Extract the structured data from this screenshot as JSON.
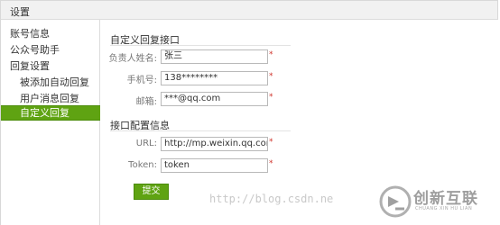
{
  "header": {
    "title": "设置"
  },
  "sidebar": {
    "items": [
      {
        "label": "账号信息"
      },
      {
        "label": "公众号助手"
      },
      {
        "label": "回复设置"
      },
      {
        "label": "被添加自动回复"
      },
      {
        "label": "用户消息回复"
      },
      {
        "label": "自定义回复"
      }
    ]
  },
  "form": {
    "section1_title": "自定义回复接口",
    "section2_title": "接口配置信息",
    "fields": {
      "name": {
        "label": "负责人姓名:",
        "value": "张三"
      },
      "phone": {
        "label": "手机号:",
        "value": "138********"
      },
      "email": {
        "label": "邮箱:",
        "value": "***@qq.com"
      },
      "url": {
        "label": "URL:",
        "value": "http://mp.weixin.qq.com/"
      },
      "token": {
        "label": "Token:",
        "value": "token"
      }
    },
    "required_mark": "*",
    "submit_label": "提交"
  },
  "watermark": {
    "text": "http://blog.csdn.ne"
  },
  "logo": {
    "text": "创新互联",
    "subtext": "CHUANG XIN HU LIAN"
  },
  "colors": {
    "accent": "#5fa312",
    "required": "#d0342c"
  }
}
